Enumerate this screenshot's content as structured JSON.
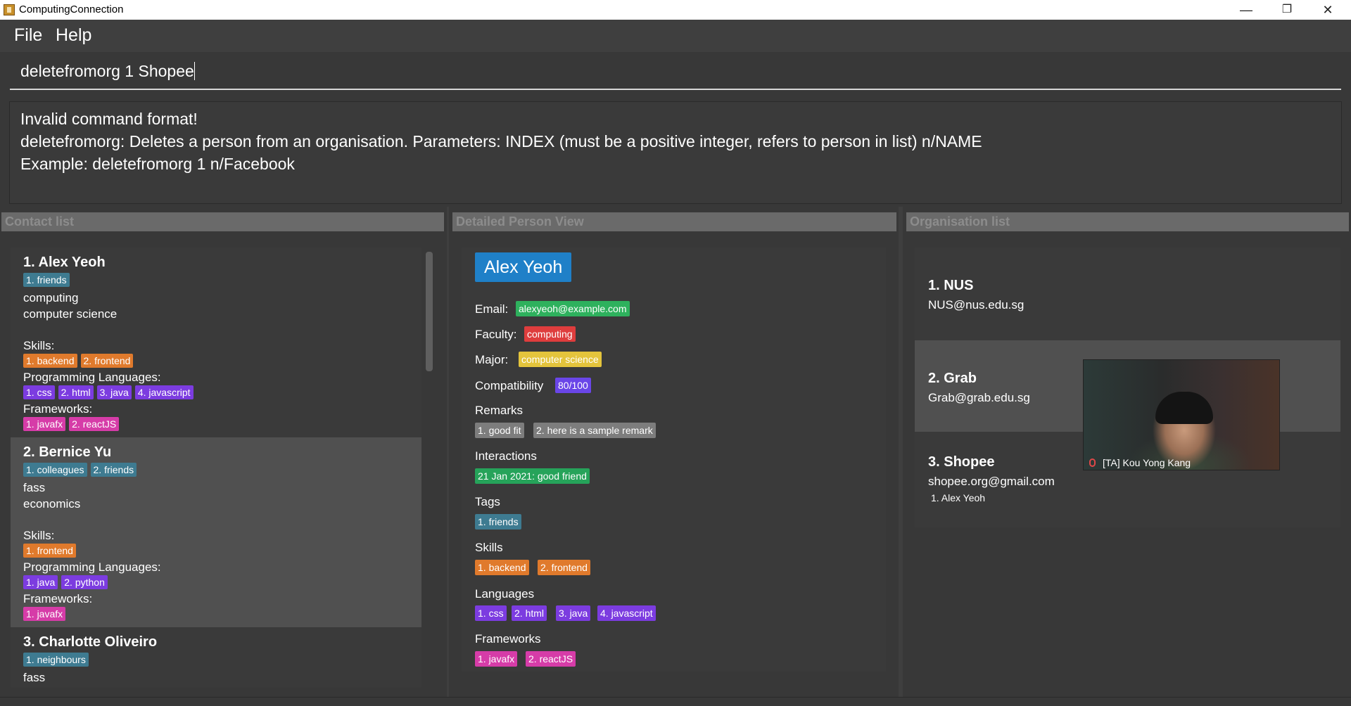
{
  "window": {
    "title": "ComputingConnection",
    "minimize": "—",
    "maximize": "❐",
    "close": "✕"
  },
  "menu": {
    "file": "File",
    "help": "Help"
  },
  "command": {
    "value": "deletefromorg 1 Shopee"
  },
  "result": {
    "line1": "Invalid command format!",
    "line2": "deletefromorg: Deletes a person from an organisation. Parameters: INDEX (must be a positive integer, refers to person in list) n/NAME",
    "line3": "Example: deletefromorg 1 n/Facebook"
  },
  "contact_panel": {
    "header": "Contact list",
    "skills_label": "Skills:",
    "prog_label": "Programming Languages:",
    "fw_label": "Frameworks:",
    "persons": [
      {
        "name": "1.  Alex Yeoh",
        "tags": [
          "1. friends"
        ],
        "faculty": "computing",
        "major": "computer science",
        "skills": [
          "1. backend",
          "2. frontend"
        ],
        "langs": [
          "1. css",
          "2. html",
          "3. java",
          "4. javascript"
        ],
        "frameworks": [
          "1. javafx",
          "2. reactJS"
        ]
      },
      {
        "name": "2.  Bernice Yu",
        "tags": [
          "1. colleagues",
          "2. friends"
        ],
        "faculty": "fass",
        "major": "economics",
        "skills": [
          "1. frontend"
        ],
        "langs": [
          "1. java",
          "2. python"
        ],
        "frameworks": [
          "1. javafx"
        ]
      },
      {
        "name": "3.  Charlotte Oliveiro",
        "tags": [
          "1. neighbours"
        ],
        "faculty": "fass"
      }
    ]
  },
  "detail_panel": {
    "header": "Detailed Person View",
    "name": "Alex Yeoh",
    "email_label": "Email:",
    "email": "alexyeoh@example.com",
    "faculty_label": "Faculty:",
    "faculty": "computing",
    "major_label": "Major:",
    "major": "computer science",
    "compat_label": "Compatibility",
    "compat": "80/100",
    "remarks_label": "Remarks",
    "remarks": [
      "1. good fit",
      "2. here is a sample remark"
    ],
    "interactions_label": "Interactions",
    "interactions": [
      "21 Jan 2021: good friend"
    ],
    "tags_label": "Tags",
    "tags": [
      "1. friends"
    ],
    "skills_label": "Skills",
    "skills": [
      "1. backend",
      "2. frontend"
    ],
    "languages_label": "Languages",
    "languages": [
      "1. css",
      "2. html",
      "3. java",
      "4. javascript"
    ],
    "frameworks_label": "Frameworks",
    "frameworks": [
      "1. javafx",
      "2. reactJS"
    ]
  },
  "org_panel": {
    "header": "Organisation list",
    "orgs": [
      {
        "name": "1.  NUS",
        "email": "NUS@nus.edu.sg"
      },
      {
        "name": "2.  Grab",
        "email": "Grab@grab.edu.sg"
      },
      {
        "name": "3.  Shopee",
        "email": "shopee.org@gmail.com",
        "members": [
          "1. Alex Yeoh"
        ]
      }
    ]
  },
  "video": {
    "caption": "[TA] Kou Yong Kang"
  },
  "colors": {
    "friends": "#3e7b91",
    "skill": "#e07a2c",
    "language": "#7c3ce0",
    "framework": "#d63ca8",
    "email": "#2eb15d",
    "faculty": "#de3d3d",
    "major": "#e4c43c",
    "compat": "#6a46e8",
    "remark": "#7d7d7d"
  }
}
